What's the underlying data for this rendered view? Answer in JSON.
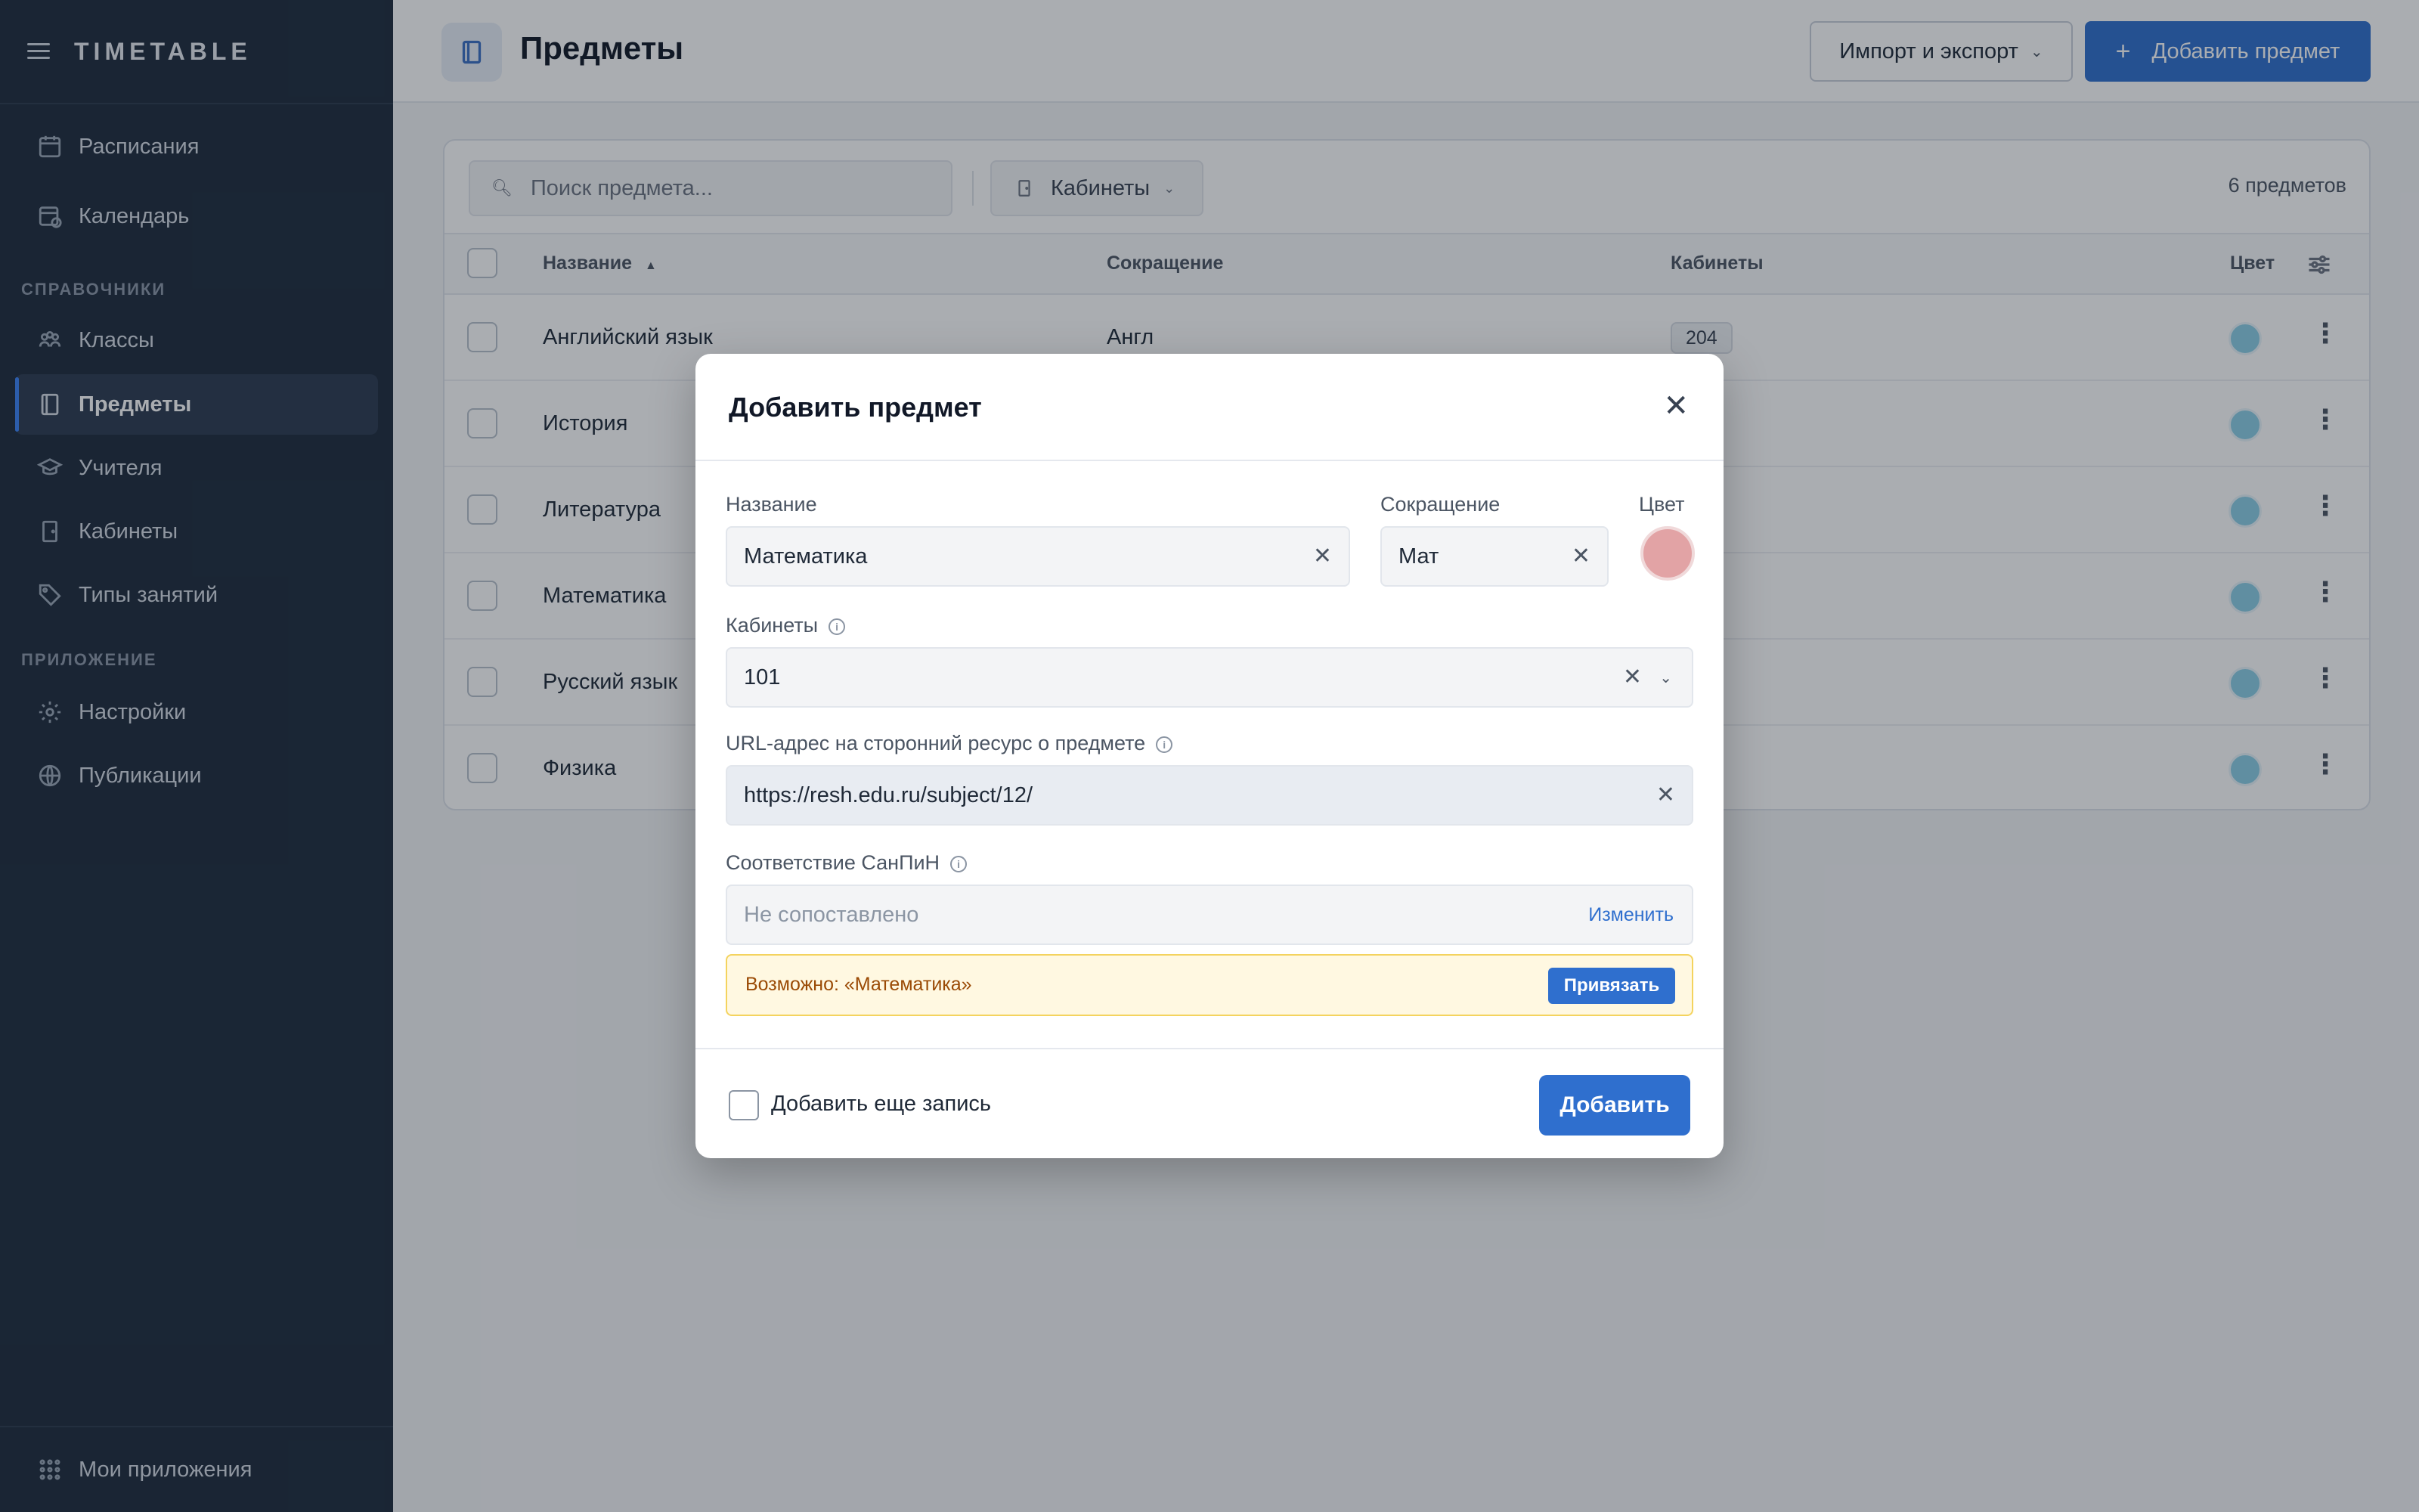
{
  "app": {
    "brand": "TIMETABLE"
  },
  "sidebar": {
    "items_top": [
      {
        "label": "Расписания",
        "icon": "calendar-grid-icon"
      },
      {
        "label": "Календарь",
        "icon": "calendar-clock-icon"
      }
    ],
    "section_refs": "СПРАВОЧНИКИ",
    "items_refs": [
      {
        "label": "Классы",
        "icon": "group-icon"
      },
      {
        "label": "Предметы",
        "icon": "book-icon",
        "active": true
      },
      {
        "label": "Учителя",
        "icon": "graduation-cap-icon"
      },
      {
        "label": "Кабинеты",
        "icon": "door-icon"
      },
      {
        "label": "Типы занятий",
        "icon": "tag-icon"
      }
    ],
    "section_app": "ПРИЛОЖЕНИЕ",
    "items_app": [
      {
        "label": "Настройки",
        "icon": "gear-icon"
      },
      {
        "label": "Публикации",
        "icon": "globe-icon"
      }
    ],
    "bottom": {
      "label": "Мои приложения",
      "icon": "apps-grid-icon"
    }
  },
  "header": {
    "title": "Предметы",
    "import_export": "Импорт и экспорт",
    "add_subject": "Добавить предмет"
  },
  "toolbar": {
    "search_placeholder": "Поиск предмета...",
    "filter_label": "Кабинеты",
    "count": "6 предметов"
  },
  "table": {
    "columns": {
      "name": "Название",
      "abbr": "Сокращение",
      "rooms": "Кабинеты",
      "color": "Цвет"
    },
    "rows": [
      {
        "name": "Английский язык",
        "abbr": "Англ",
        "room": "204"
      },
      {
        "name": "История",
        "abbr": "",
        "room": ""
      },
      {
        "name": "Литература",
        "abbr": "",
        "room": ""
      },
      {
        "name": "Математика",
        "abbr": "",
        "room": ""
      },
      {
        "name": "Русский язык",
        "abbr": "",
        "room": ""
      },
      {
        "name": "Физика",
        "abbr": "",
        "room": ""
      }
    ],
    "row_color": "#8bcfe6"
  },
  "modal": {
    "title": "Добавить предмет",
    "name_label": "Название",
    "name_value": "Математика",
    "abbr_label": "Сокращение",
    "abbr_value": "Мат",
    "color_label": "Цвет",
    "color_value": "#e2a3a5",
    "rooms_label": "Кабинеты",
    "rooms_value": "101",
    "url_label": "URL-адрес на сторонний ресурс о предмете",
    "url_value": "https://resh.edu.ru/subject/12/",
    "sanpin_label": "Соответствие СанПиН",
    "sanpin_value": "Не сопоставлено",
    "sanpin_change": "Изменить",
    "hint_text": "Возможно: «Математика»",
    "hint_button": "Привязать",
    "add_more_label": "Добавить еще запись",
    "submit": "Добавить"
  },
  "colors": {
    "primary": "#2f6fce",
    "sidebar_bg": "#1e2b3c",
    "warning_bg": "#fff8e1"
  }
}
